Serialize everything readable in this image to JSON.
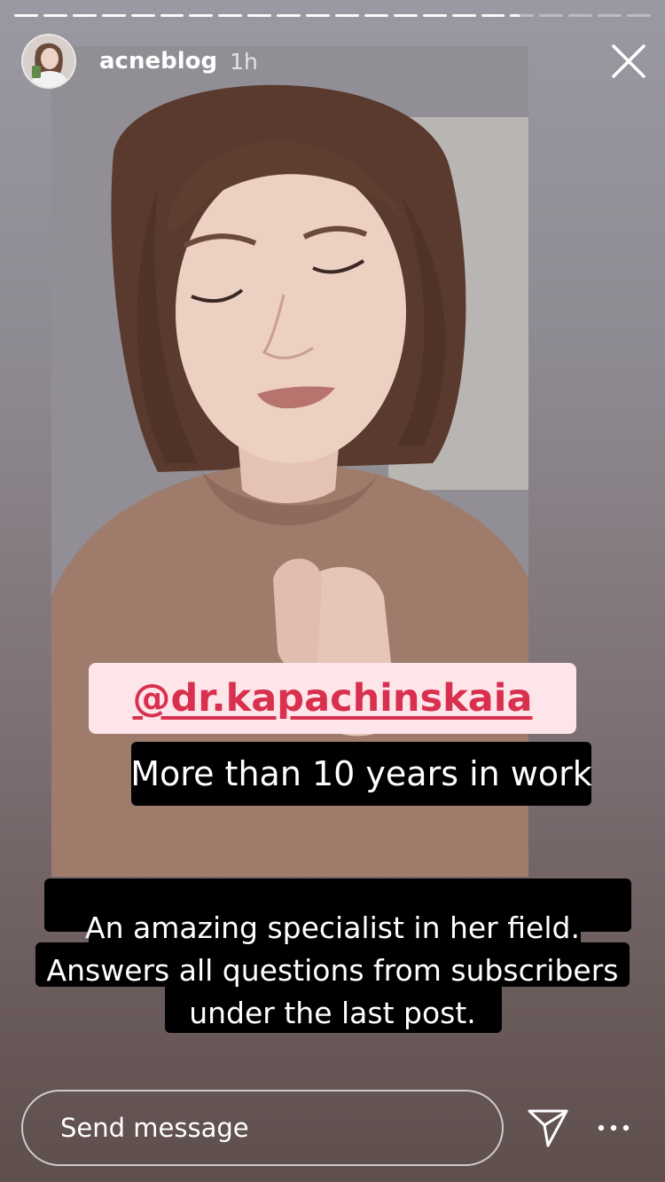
{
  "story": {
    "segments_total": 22,
    "segments_done": 17,
    "current_progress": 0.4
  },
  "header": {
    "username": "acneblog",
    "time": "1h",
    "avatar_icon": "profile-photo"
  },
  "stickers": {
    "mention": "@dr.kapachinskaia",
    "caption_short": "More than 10 years in work",
    "caption_long": [
      "An amazing specialist in her field.",
      "Answers all questions from subscribers",
      "under the last post."
    ]
  },
  "footer": {
    "message_placeholder": "Send message",
    "send_icon": "paper-plane-icon",
    "more_icon": "more-dots-icon"
  },
  "colors": {
    "mention_bg": "#fde5ea",
    "mention_text": "#d8304e",
    "caption_bg": "#000000"
  }
}
